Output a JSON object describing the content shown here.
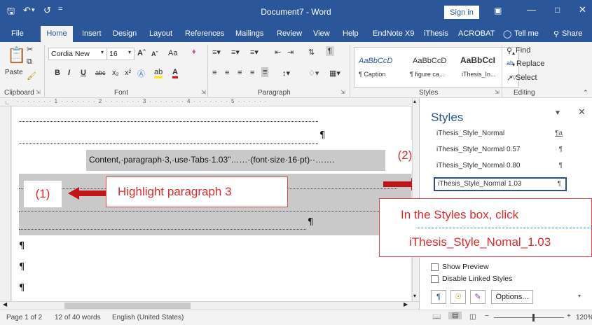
{
  "titlebar": {
    "title": "Document7  -  Word",
    "signin": "Sign in"
  },
  "tabs": [
    "File",
    "Home",
    "Insert",
    "Design",
    "Layout",
    "References",
    "Mailings",
    "Review",
    "View",
    "Help",
    "EndNote X9",
    "iThesis",
    "ACROBAT",
    "Tell me",
    "Share"
  ],
  "ribbon": {
    "paste": "Paste",
    "font_name": "Cordia New",
    "font_size": "16",
    "aa": "Aa",
    "clipboard": "Clipboard",
    "font": "Font",
    "paragraph": "Paragraph",
    "styles": "Styles",
    "editing": "Editing",
    "find": "Find",
    "replace": "Replace",
    "select": "Select",
    "gallery": [
      {
        "preview": "AaBbCcD",
        "name": "¶ Caption"
      },
      {
        "preview": "AaBbCcD",
        "name": "¶ figure ca..."
      },
      {
        "preview": "AaBbCcI",
        "name": "iThesis_In..."
      }
    ]
  },
  "document": {
    "pilcrow": "¶",
    "content_line": "Content,·paragraph·3,·use·Tabs·1.03\"……·(font·size·16·pt)··…….",
    "label_1": "(1)",
    "label_2": "(2)",
    "callout_highlight": "Highlight paragraph 3",
    "note_line1": "In the Styles box, click",
    "note_line2": "iThesis_Style_Nomal_1.03"
  },
  "styles_pane": {
    "title": "Styles",
    "items": [
      {
        "name": "iThesis_Style_Normal",
        "mark": "¶a"
      },
      {
        "name": "iThesis_Style_Normal 0.57",
        "mark": "¶"
      },
      {
        "name": "iThesis_Style_Normal 0.80",
        "mark": "¶"
      },
      {
        "name": "iThesis_Style_Normal 1.03",
        "mark": "¶"
      }
    ],
    "show_preview": "Show Preview",
    "disable_linked": "Disable Linked Styles",
    "options": "Options..."
  },
  "statusbar": {
    "page": "Page 1 of 2",
    "words": "12 of 40 words",
    "language": "English (United States)",
    "zoom": "120%"
  },
  "colors": {
    "accent": "#2b579a",
    "callout": "#d92b2b",
    "highlight": "#c9c9c9"
  }
}
